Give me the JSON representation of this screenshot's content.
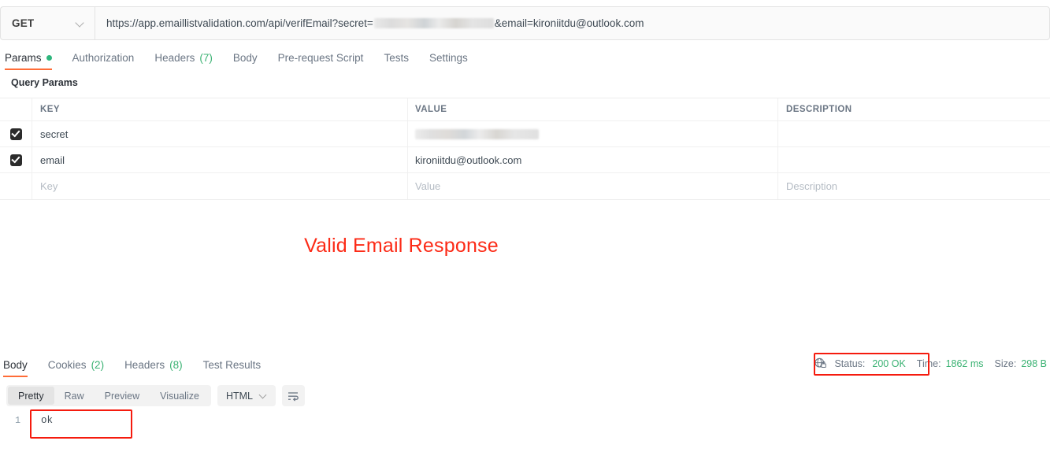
{
  "request": {
    "method": "GET",
    "url_prefix": "https://app.emaillistvalidation.com/api/verifEmail?secret=",
    "url_suffix": "&email=kironiitdu@outlook.com",
    "secret_redacted": true
  },
  "request_tabs": [
    {
      "label": "Params",
      "active": true,
      "dot": true
    },
    {
      "label": "Authorization",
      "active": false
    },
    {
      "label": "Headers",
      "count": "(7)",
      "active": false
    },
    {
      "label": "Body",
      "active": false
    },
    {
      "label": "Pre-request Script",
      "active": false
    },
    {
      "label": "Tests",
      "active": false
    },
    {
      "label": "Settings",
      "active": false
    }
  ],
  "query_params": {
    "section_title": "Query Params",
    "columns": {
      "key": "KEY",
      "value": "VALUE",
      "description": "DESCRIPTION"
    },
    "rows": [
      {
        "checked": true,
        "key": "secret",
        "value": "",
        "value_redacted": true,
        "description": ""
      },
      {
        "checked": true,
        "key": "email",
        "value": "kironiitdu@outlook.com",
        "description": ""
      }
    ],
    "placeholder_row": {
      "key": "Key",
      "value": "Value",
      "description": "Description"
    }
  },
  "annotation": {
    "title": "Valid Email Response",
    "title_color": "#fc2a16",
    "box_color": "#f51b0e"
  },
  "response_tabs": [
    {
      "label": "Body",
      "active": true
    },
    {
      "label": "Cookies",
      "count": "(2)",
      "active": false
    },
    {
      "label": "Headers",
      "count": "(8)",
      "active": false
    },
    {
      "label": "Test Results",
      "active": false
    }
  ],
  "response_meta": {
    "icon": "globe-lock-icon",
    "status_label": "Status:",
    "status_value": "200 OK",
    "time_label": "Time:",
    "time_value": "1862 ms",
    "size_label": "Size:",
    "size_value": "298 B",
    "value_color": "#3bb273"
  },
  "view_toolbar": {
    "modes": [
      {
        "label": "Pretty",
        "active": true
      },
      {
        "label": "Raw",
        "active": false
      },
      {
        "label": "Preview",
        "active": false
      },
      {
        "label": "Visualize",
        "active": false
      }
    ],
    "language": "HTML",
    "wrap_icon": "wrap-lines-icon"
  },
  "response_body": {
    "lines": [
      {
        "num": "1",
        "text": "ok"
      }
    ]
  }
}
